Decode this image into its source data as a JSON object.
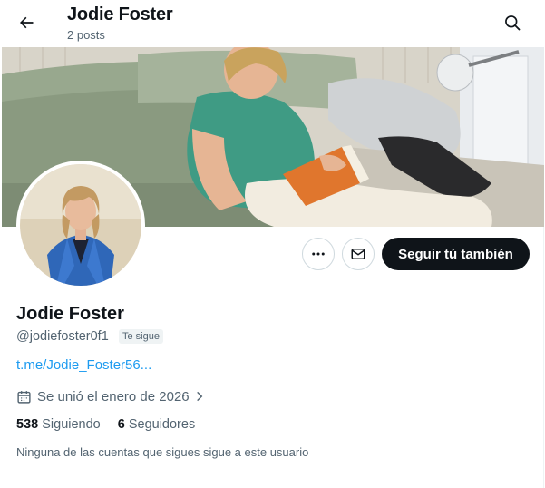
{
  "header": {
    "back_icon": "arrow-left-icon",
    "title": "Jodie Foster",
    "subtitle": "2 posts",
    "search_icon": "search-icon"
  },
  "profile": {
    "display_name": "Jodie Foster",
    "handle": "@jodiefoster0f1",
    "follows_you_badge": "Te sigue",
    "link": "t.me/Jodie_Foster56...",
    "joined": "Se unió el enero de 2026",
    "following_count": "538",
    "following_label": "Siguiendo",
    "followers_count": "6",
    "followers_label": "Seguidores",
    "followed_by_note": "Ninguna de las cuentas que sigues sigue a este usuario"
  },
  "actions": {
    "more_icon": "more-icon",
    "message_icon": "mail-icon",
    "follow_back_label": "Seguir tú también"
  },
  "colors": {
    "accent": "#1d9bf0",
    "text_primary": "#0f1419",
    "text_secondary": "#536471",
    "follow_button_bg": "#0f1419"
  }
}
